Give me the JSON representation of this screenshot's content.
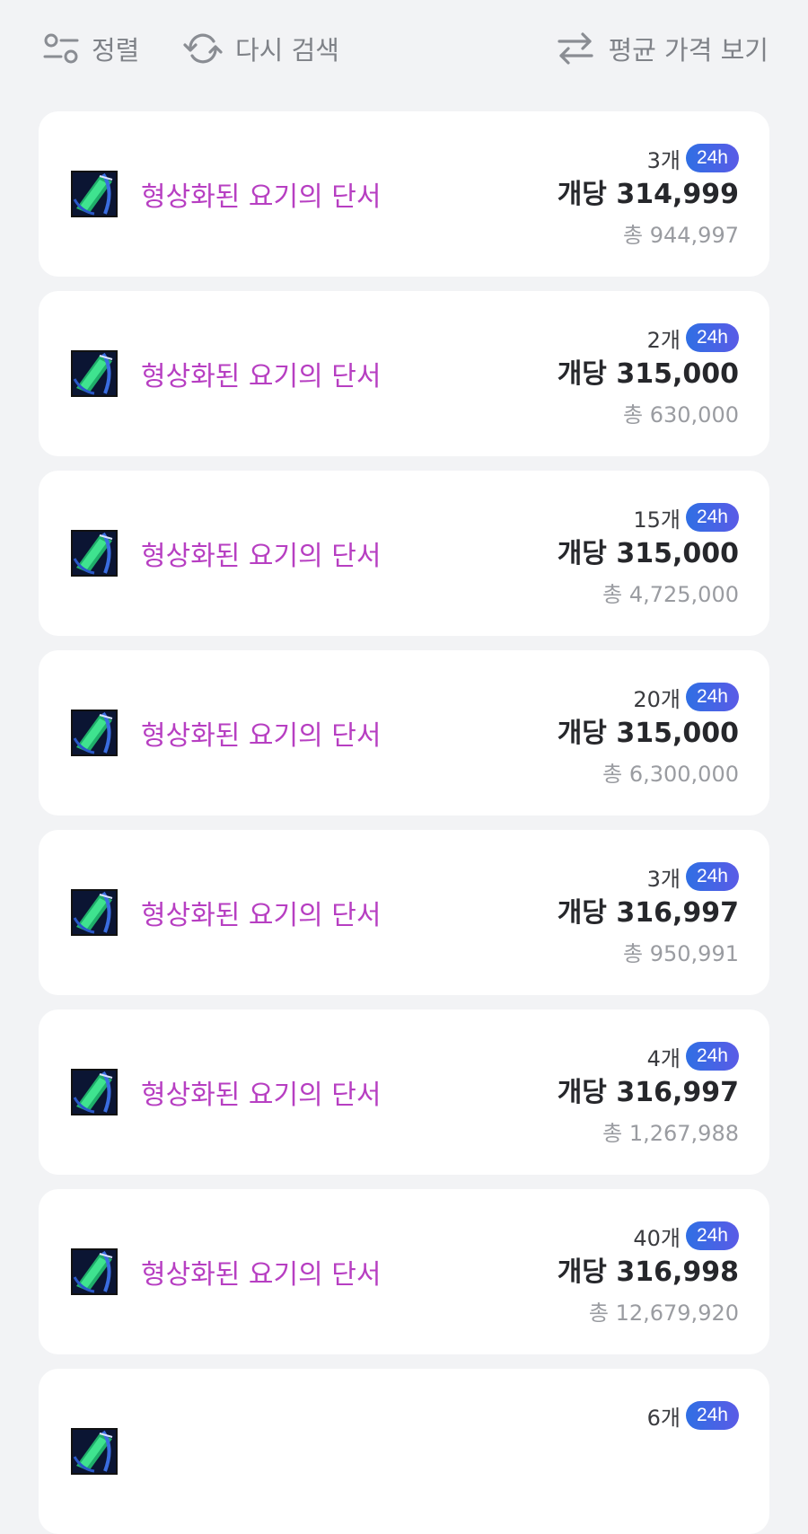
{
  "toolbar": {
    "sort_label": "정렬",
    "retry_label": "다시 검색",
    "avg_label": "평균 가격 보기",
    "sort_icon": "sort-sliders-icon",
    "retry_icon": "refresh-icon",
    "avg_icon": "swap-arrows-icon"
  },
  "colors": {
    "item_name": "#b73fc2",
    "badge_gradient_start": "#2f6fe4",
    "badge_gradient_end": "#5a5be6",
    "background": "#f2f3f5"
  },
  "listings": [
    {
      "name": "형상화된 요기의 단서",
      "qty": "3개",
      "badge": "24h",
      "unit_price": "개당 314,999",
      "total": "총 944,997"
    },
    {
      "name": "형상화된 요기의 단서",
      "qty": "2개",
      "badge": "24h",
      "unit_price": "개당 315,000",
      "total": "총 630,000"
    },
    {
      "name": "형상화된 요기의 단서",
      "qty": "15개",
      "badge": "24h",
      "unit_price": "개당 315,000",
      "total": "총 4,725,000"
    },
    {
      "name": "형상화된 요기의 단서",
      "qty": "20개",
      "badge": "24h",
      "unit_price": "개당 315,000",
      "total": "총 6,300,000"
    },
    {
      "name": "형상화된 요기의 단서",
      "qty": "3개",
      "badge": "24h",
      "unit_price": "개당 316,997",
      "total": "총 950,991"
    },
    {
      "name": "형상화된 요기의 단서",
      "qty": "4개",
      "badge": "24h",
      "unit_price": "개당 316,997",
      "total": "총 1,267,988"
    },
    {
      "name": "형상화된 요기의 단서",
      "qty": "40개",
      "badge": "24h",
      "unit_price": "개당 316,998",
      "total": "총 12,679,920"
    },
    {
      "name": "",
      "qty": "6개",
      "badge": "24h",
      "unit_price": "",
      "total": ""
    }
  ]
}
